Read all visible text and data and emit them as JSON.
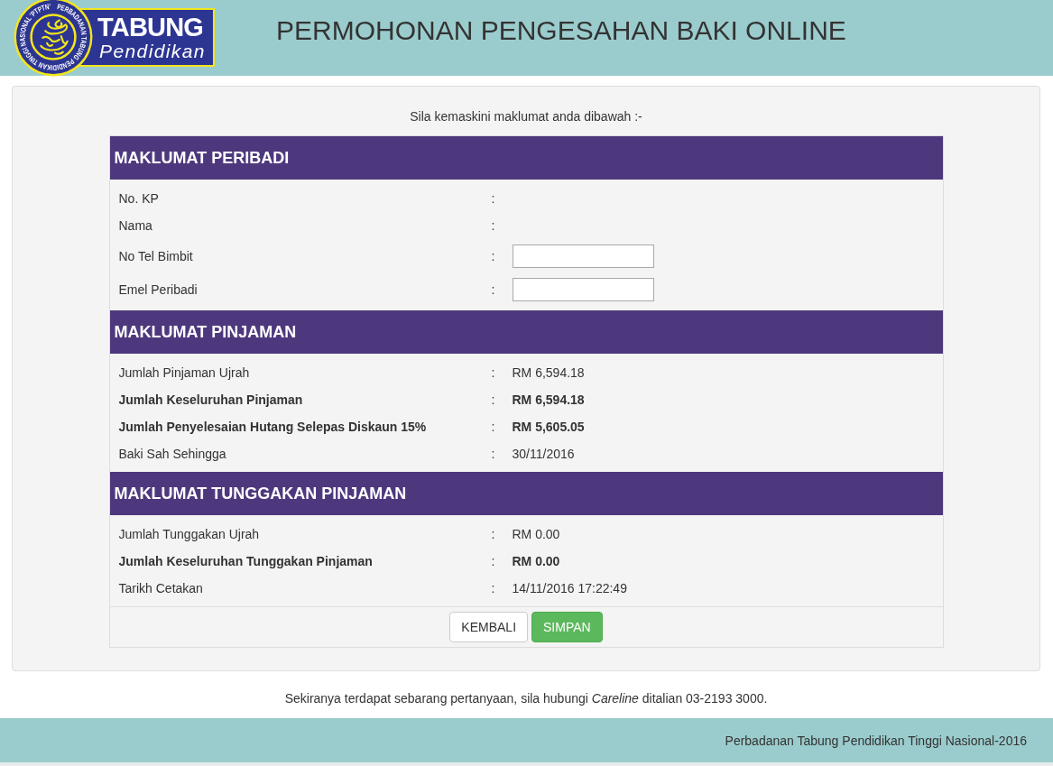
{
  "header": {
    "logo": {
      "seal_text": "PERBADANAN TABUNG PENDIDIKAN TINGGI NASIONAL 'PTPTN'",
      "wordmark": "TABUNG",
      "tagline": "Pendidikan"
    },
    "title": "PERMOHONAN PENGESAHAN BAKI ONLINE"
  },
  "form": {
    "intro": "Sila kemaskini maklumat anda dibawah :-",
    "sections": [
      {
        "title": "MAKLUMAT PERIBADI",
        "rows": [
          {
            "kind": "text",
            "label": "No. KP",
            "separator": ":",
            "bold": false
          },
          {
            "kind": "text",
            "label": "Nama",
            "separator": ":",
            "bold": false
          },
          {
            "kind": "input",
            "label": "No Tel Bimbit",
            "separator": ":",
            "bold": false
          },
          {
            "kind": "input",
            "label": "Emel Peribadi",
            "separator": ":",
            "bold": false
          }
        ]
      },
      {
        "title": "MAKLUMAT PINJAMAN",
        "rows": [
          {
            "kind": "text",
            "label": "Jumlah Pinjaman Ujrah",
            "separator": ":",
            "value": "RM 6,594.18",
            "bold": false
          },
          {
            "kind": "text",
            "label": "Jumlah Keseluruhan Pinjaman",
            "separator": ":",
            "value": "RM 6,594.18",
            "bold": true
          },
          {
            "kind": "text",
            "label": "Jumlah Penyelesaian Hutang Selepas Diskaun 15%",
            "separator": ":",
            "value": "RM 5,605.05",
            "bold": true
          },
          {
            "kind": "text",
            "label": "Baki Sah Sehingga",
            "separator": ":",
            "value": "30/11/2016",
            "bold": false
          }
        ]
      },
      {
        "title": "MAKLUMAT TUNGGAKAN PINJAMAN",
        "rows": [
          {
            "kind": "text",
            "label": "Jumlah Tunggakan Ujrah",
            "separator": ":",
            "value": "RM 0.00",
            "bold": false
          },
          {
            "kind": "text",
            "label": "Jumlah Keseluruhan Tunggakan Pinjaman",
            "separator": ":",
            "value": "RM 0.00",
            "bold": true
          },
          {
            "kind": "text",
            "label": "Tarikh Cetakan",
            "separator": ":",
            "value": "14/11/2016 17:22:49",
            "bold": false
          }
        ]
      }
    ],
    "buttons": [
      {
        "kind": "back",
        "label": "KEMBALI"
      },
      {
        "kind": "save",
        "label": "SIMPAN"
      }
    ]
  },
  "contact_note": "Sekiranya terdapat sebarang pertanyaan, sila hubungi *Careline* ditalian 03-2193 3000.",
  "footer": {
    "text": "Perbadanan Tabung Pendidikan Tinggi Nasional-2016"
  }
}
